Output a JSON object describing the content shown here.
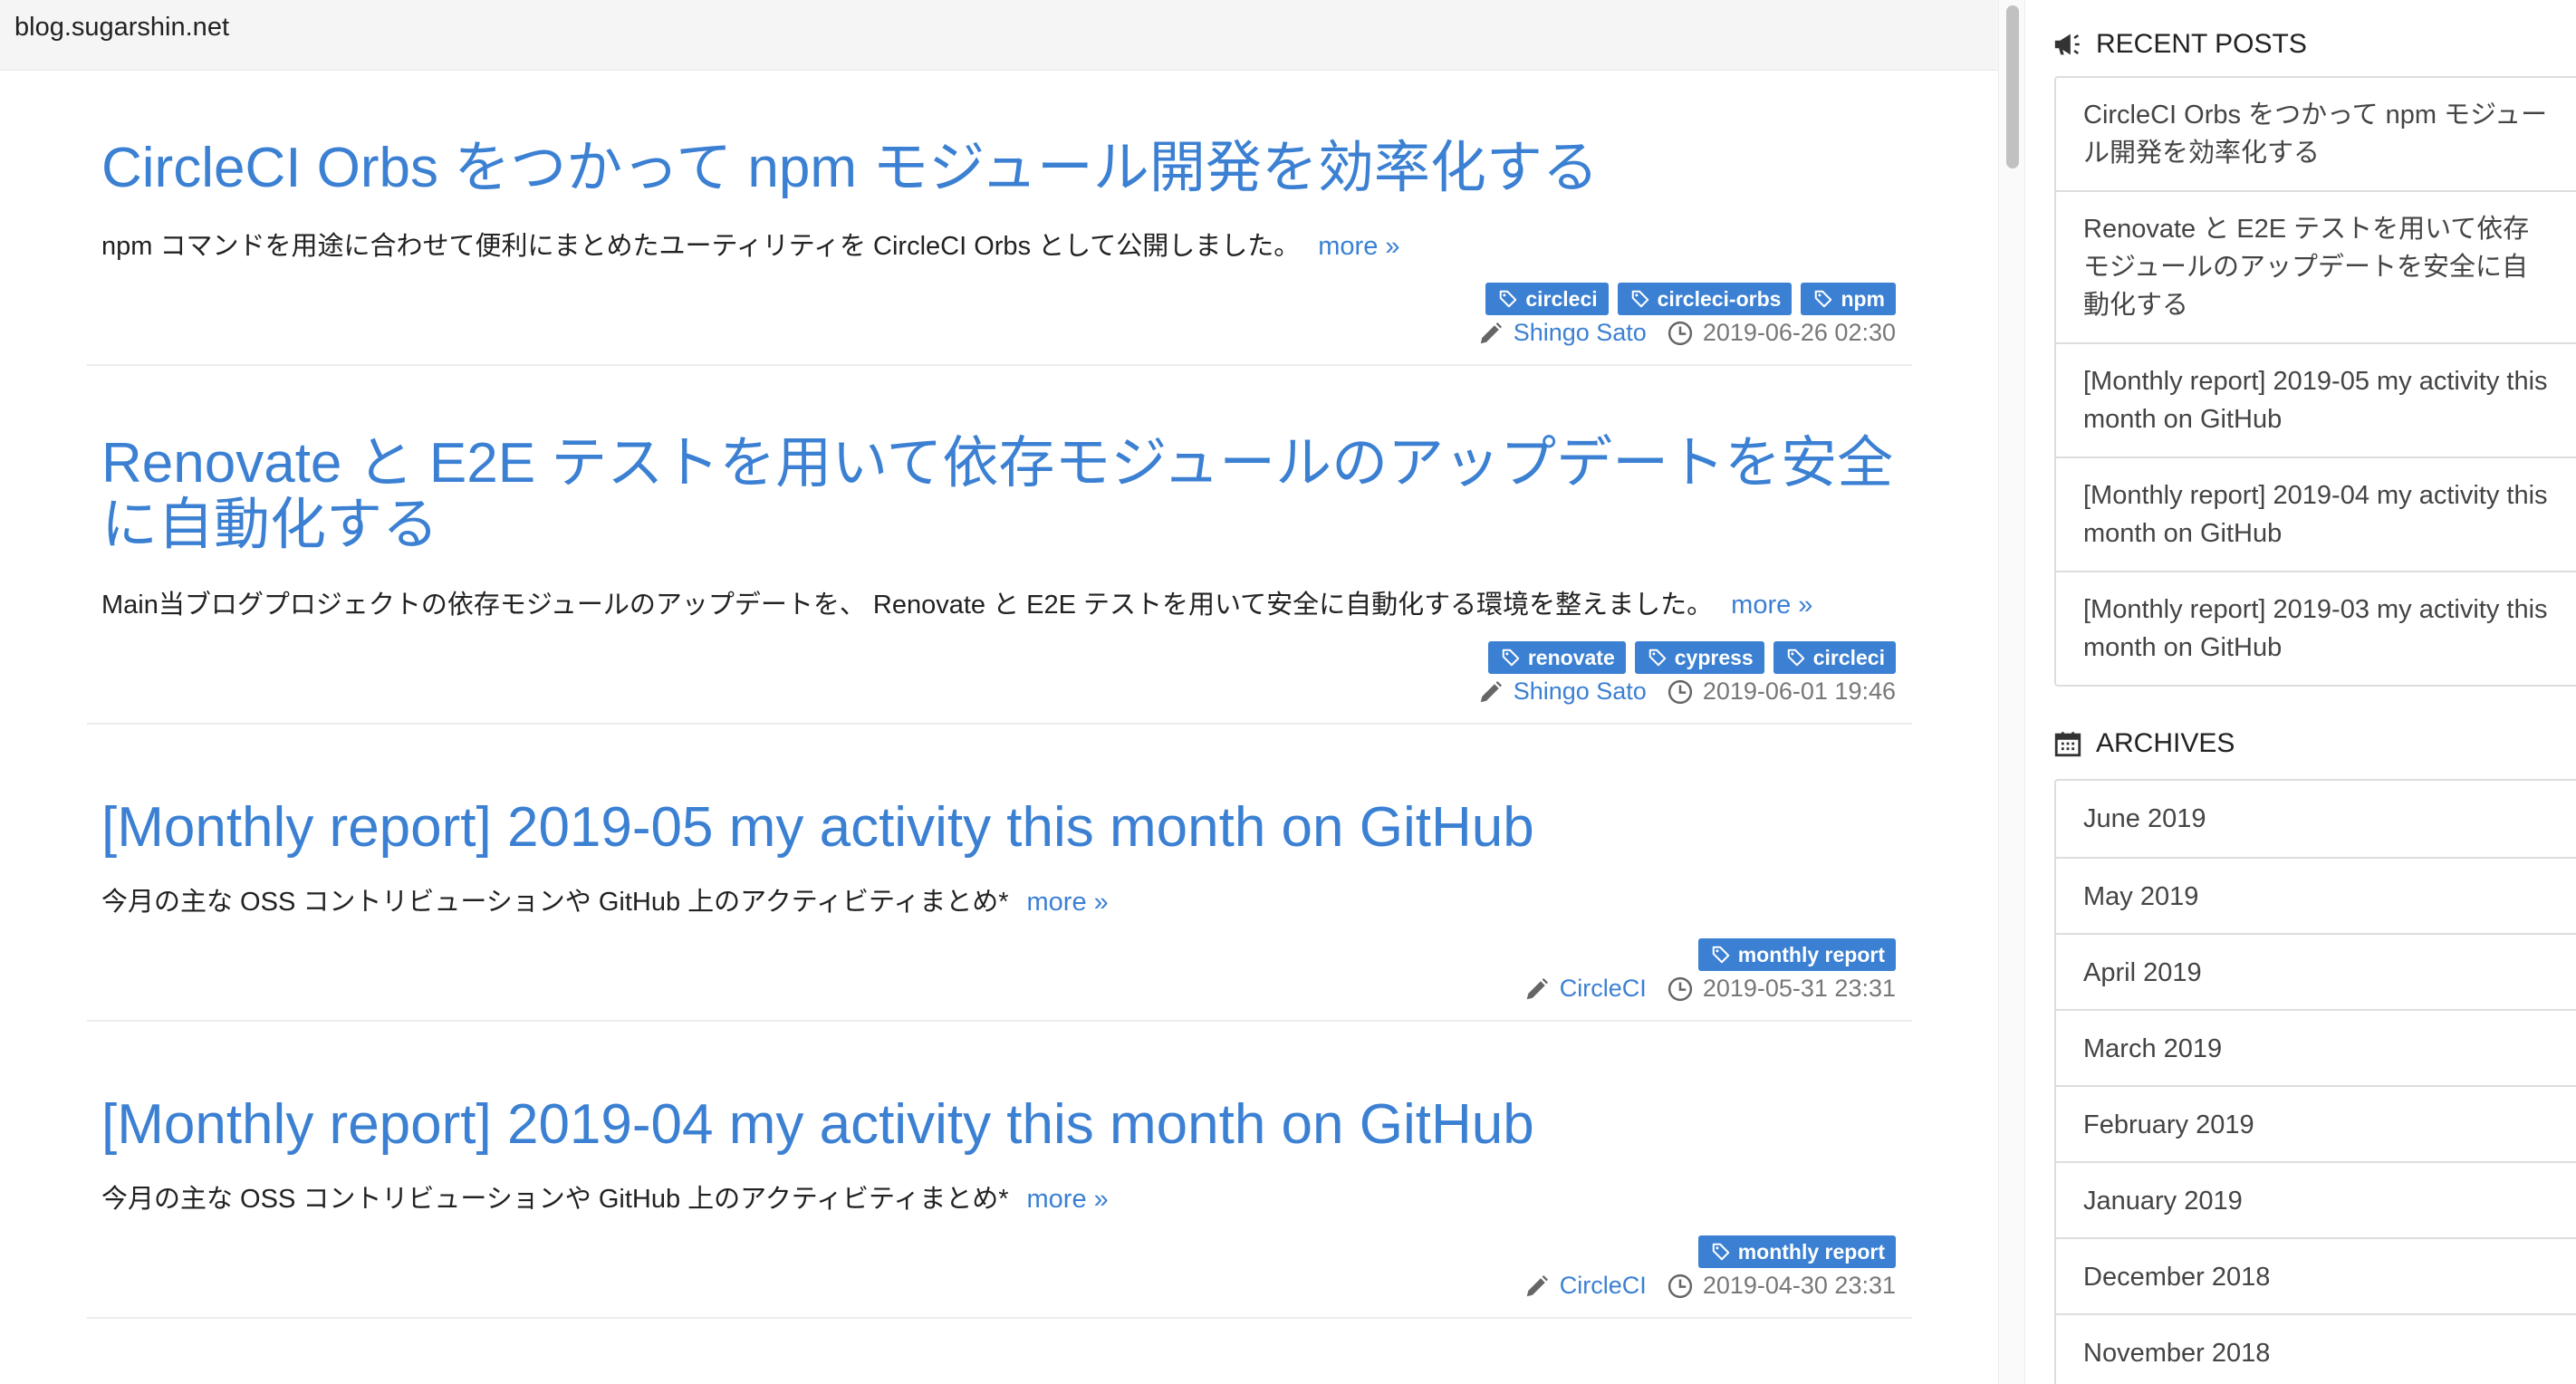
{
  "urlbar": {
    "url": "blog.sugarshin.net"
  },
  "posts": [
    {
      "title": "CircleCI Orbs をつかって npm モジュール開発を効率化する",
      "summary": "npm コマンドを用途に合わせて便利にまとめたユーティリティを CircleCI Orbs として公開しました。",
      "more": "more »",
      "tags": [
        "circleci",
        "circleci-orbs",
        "npm"
      ],
      "author": "Shingo Sato",
      "date": "2019-06-26 02:30"
    },
    {
      "title": "Renovate と E2E テストを用いて依存モジュールのアップデートを安全に自動化する",
      "summary": "Main当ブログプロジェクトの依存モジュールのアップデートを、 Renovate と E2E テストを用いて安全に自動化する環境を整えました。",
      "more": "more »",
      "tags": [
        "renovate",
        "cypress",
        "circleci"
      ],
      "author": "Shingo Sato",
      "date": "2019-06-01 19:46"
    },
    {
      "title": "[Monthly report] 2019-05 my activity this month on GitHub",
      "summary": "今月の主な OSS コントリビューションや GitHub 上のアクティビティまとめ*",
      "more": "more »",
      "tags": [
        "monthly report"
      ],
      "author": "CircleCI",
      "date": "2019-05-31 23:31"
    },
    {
      "title": "[Monthly report] 2019-04 my activity this month on GitHub",
      "summary": "今月の主な OSS コントリビューションや GitHub 上のアクティビティまとめ*",
      "more": "more »",
      "tags": [
        "monthly report"
      ],
      "author": "CircleCI",
      "date": "2019-04-30 23:31"
    }
  ],
  "sidebar": {
    "recent_heading": "RECENT POSTS",
    "recent_icon": "megaphone-icon",
    "recent": [
      "CircleCI Orbs をつかって npm モジュール開発を効率化する",
      "Renovate と E2E テストを用いて依存モジュールのアップデートを安全に自動化する",
      "[Monthly report] 2019-05 my activity this month on GitHub",
      "[Monthly report] 2019-04 my activity this month on GitHub",
      "[Monthly report] 2019-03 my activity this month on GitHub"
    ],
    "archives_heading": "ARCHIVES",
    "archives_icon": "calendar-icon",
    "archives": [
      "June 2019",
      "May 2019",
      "April 2019",
      "March 2019",
      "February 2019",
      "January 2019",
      "December 2018",
      "November 2018"
    ]
  },
  "colors": {
    "link": "#3b80d2",
    "tag_bg": "#3b80d2",
    "meta": "#777777"
  }
}
